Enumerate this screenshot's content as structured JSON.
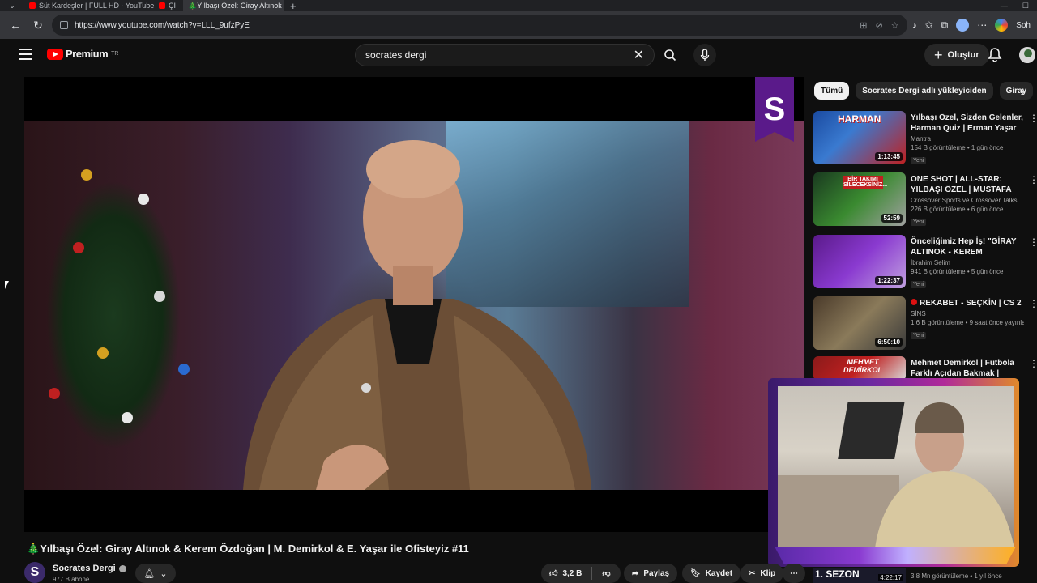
{
  "browser": {
    "tabs": [
      {
        "label": "Süt Kardeşler | FULL HD - YouTube",
        "active": false
      },
      {
        "label": "Çİ",
        "active": false
      },
      {
        "label": "🎄Yılbaşı Özel: Giray Altınok",
        "active": true
      }
    ],
    "url": "https://www.youtube.com/watch?v=LLL_9ufzPyE",
    "side_label": "Soh"
  },
  "header": {
    "logo_text": "Premium",
    "logo_sup": "TR",
    "search_query": "socrates dergi",
    "create_label": "Oluştur"
  },
  "player": {
    "channel_logo_letter": "S"
  },
  "chips": [
    "Tümü",
    "Socrates Dergi adlı yükleyiciden",
    "Giray"
  ],
  "recommendations": [
    {
      "title": "Yılbaşı Özel, Sizden Gelenler, Harman Quiz | Erman Yaşar & ...",
      "channel": "Mantra",
      "meta": "154 B görüntüleme • 1 gün önce",
      "badge": "Yeni",
      "duration": "1:13:45"
    },
    {
      "title": "ONE SHOT | ALL-STAR: YILBAŞI ÖZEL | MUSTAFA DEMİRTAŞ, ...",
      "channel": "Crossover Sports ve Crossover Talks",
      "meta": "226 B görüntüleme • 6 gün önce",
      "badge": "Yeni",
      "duration": "52:59"
    },
    {
      "title": "Önceliğimiz Hep İş! \"GİRAY ALTINOK - KEREM ÖZDOĞAN\" ...",
      "channel": "İbrahim Selim",
      "meta": "941 B görüntüleme • 5 gün önce",
      "badge": "Yeni",
      "duration": "1:22:37"
    },
    {
      "title": "REKABET - SEÇKİN | CS 2",
      "channel": "SİNS",
      "meta": "1,6 B görüntüleme • 9 saat önce yayınlan...",
      "badge": "Yeni",
      "duration": "6:50:10"
    },
    {
      "title": "Mehmet Demirkol | Futbola Farklı Açıdan Bakmak | Kimsin...",
      "channel": "",
      "meta": "",
      "badge": "",
      "duration": ""
    }
  ],
  "thumb_texts": {
    "rec1": "HARMAN",
    "rec2": "BİR TAKIMI SİLECEKSİNİZ...",
    "rec5": "MEHMET DEMİRKOL"
  },
  "bottom_rec": {
    "label": "1. SEZON",
    "duration": "4:22:17",
    "meta": "3,8 Mn görüntüleme • 1 yıl önce"
  },
  "video": {
    "title": "Yılbaşı Özel: Giray Altınok & Kerem Özdoğan | M. Demirkol & E. Yaşar ile Ofisteyiz #11",
    "title_prefix": "🎄",
    "channel": "Socrates Dergi",
    "channel_avatar_letter": "S",
    "subscribers": "977 B abone",
    "likes": "3,2 B",
    "share": "Paylaş",
    "save": "Kaydet",
    "clip": "Klip"
  }
}
